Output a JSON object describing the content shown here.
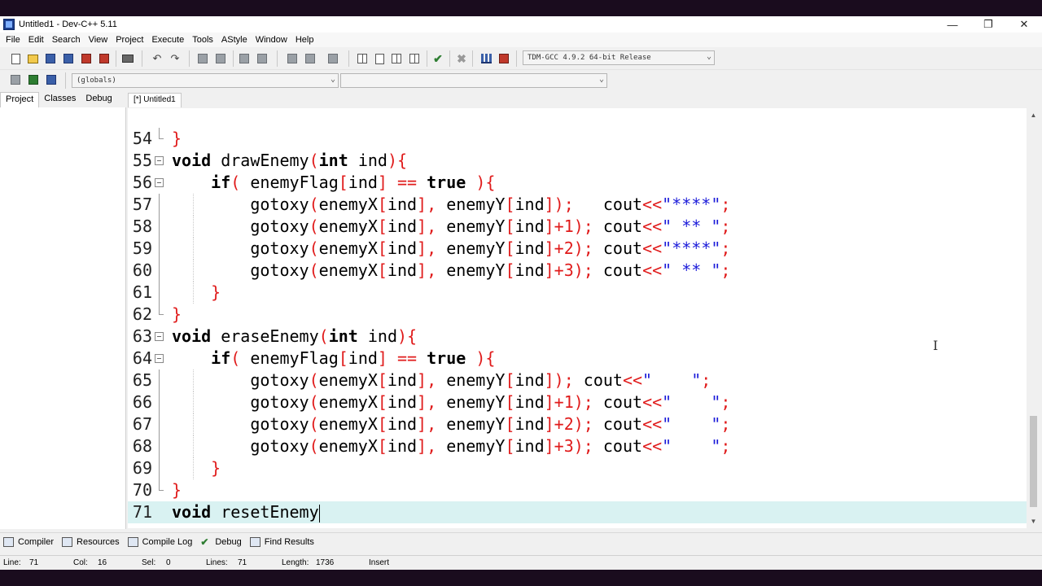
{
  "window": {
    "title": "Untitled1 - Dev-C++ 5.11",
    "controls": {
      "minimize": "—",
      "maximize": "❐",
      "close": "✕"
    }
  },
  "menu": [
    "File",
    "Edit",
    "Search",
    "View",
    "Project",
    "Execute",
    "Tools",
    "AStyle",
    "Window",
    "Help"
  ],
  "toolbar": {
    "compiler_select": "TDM-GCC 4.9.2 64-bit Release",
    "scope_select": "(globals)",
    "member_select": ""
  },
  "left_panel": {
    "tabs": [
      "Project",
      "Classes",
      "Debug"
    ],
    "active_tab": "Project"
  },
  "editor": {
    "tab_label": "[*] Untitled1",
    "lines": [
      {
        "n": "54",
        "text": "}"
      },
      {
        "n": "55",
        "text": "void drawEnemy(int ind){"
      },
      {
        "n": "56",
        "text": "    if( enemyFlag[ind] == true ){"
      },
      {
        "n": "57",
        "text": "        gotoxy(enemyX[ind], enemyY[ind]);   cout<<\"****\";"
      },
      {
        "n": "58",
        "text": "        gotoxy(enemyX[ind], enemyY[ind]+1); cout<<\" ** \";"
      },
      {
        "n": "59",
        "text": "        gotoxy(enemyX[ind], enemyY[ind]+2); cout<<\"****\";"
      },
      {
        "n": "60",
        "text": "        gotoxy(enemyX[ind], enemyY[ind]+3); cout<<\" ** \";"
      },
      {
        "n": "61",
        "text": "    }"
      },
      {
        "n": "62",
        "text": "}"
      },
      {
        "n": "63",
        "text": "void eraseEnemy(int ind){"
      },
      {
        "n": "64",
        "text": "    if( enemyFlag[ind] == true ){"
      },
      {
        "n": "65",
        "text": "        gotoxy(enemyX[ind], enemyY[ind]); cout<<\"    \";"
      },
      {
        "n": "66",
        "text": "        gotoxy(enemyX[ind], enemyY[ind]+1); cout<<\"    \";"
      },
      {
        "n": "67",
        "text": "        gotoxy(enemyX[ind], enemyY[ind]+2); cout<<\"    \";"
      },
      {
        "n": "68",
        "text": "        gotoxy(enemyX[ind], enemyY[ind]+3); cout<<\"    \";"
      },
      {
        "n": "69",
        "text": "    }"
      },
      {
        "n": "70",
        "text": "}"
      },
      {
        "n": "71",
        "text": "void resetEnemy"
      }
    ],
    "current_line": "71"
  },
  "bottom_tabs": [
    "Compiler",
    "Resources",
    "Compile Log",
    "Debug",
    "Find Results"
  ],
  "status": {
    "line_label": "Line:",
    "line": "71",
    "col_label": "Col:",
    "col": "16",
    "sel_label": "Sel:",
    "sel": "0",
    "lines_label": "Lines:",
    "lines": "71",
    "length_label": "Length:",
    "length": "1736",
    "mode": "Insert"
  },
  "colors": {
    "keyword": "#000000",
    "symbol": "#e01b1b",
    "string": "#1a1ad9",
    "current_line_bg": "#d9f2f2"
  }
}
